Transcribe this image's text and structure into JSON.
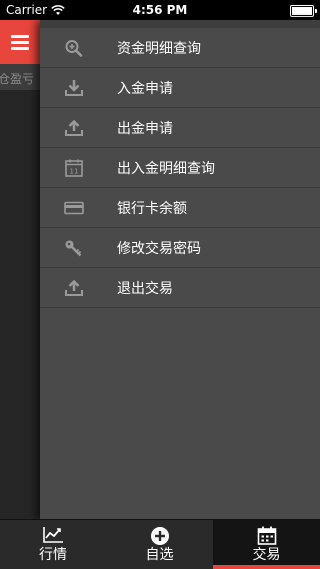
{
  "status_bar": {
    "carrier": "Carrier",
    "time": "4:56 PM"
  },
  "left_panel": {
    "sub_label": "仓盈亏"
  },
  "menu": {
    "items": [
      {
        "label": "资金明细查询",
        "icon": "search-plus-icon"
      },
      {
        "label": "入金申请",
        "icon": "download-icon"
      },
      {
        "label": "出金申请",
        "icon": "upload-icon"
      },
      {
        "label": "出入金明细查询",
        "icon": "calendar-icon",
        "icon_text": "11"
      },
      {
        "label": "银行卡余额",
        "icon": "credit-card-icon"
      },
      {
        "label": "修改交易密码",
        "icon": "key-icon"
      },
      {
        "label": "退出交易",
        "icon": "upload-icon"
      }
    ]
  },
  "tabs": [
    {
      "label": "行情",
      "icon": "chart-icon"
    },
    {
      "label": "自选",
      "icon": "plus-circle-icon"
    },
    {
      "label": "交易",
      "icon": "calendar-icon",
      "active": true
    }
  ],
  "colors": {
    "accent": "#e8453c",
    "drawer_bg": "#4a4a4a",
    "icon_gray": "#9a9a9a"
  }
}
